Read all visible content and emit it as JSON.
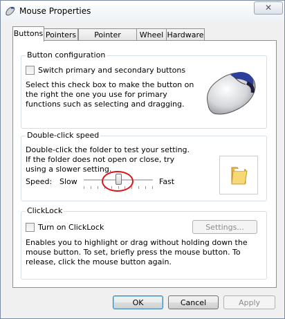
{
  "window": {
    "title": "Mouse Properties",
    "close_symbol": "✕"
  },
  "tabs": [
    {
      "label": "Buttons",
      "active": true
    },
    {
      "label": "Pointers",
      "active": false
    },
    {
      "label": "Pointer Options",
      "active": false
    },
    {
      "label": "Wheel",
      "active": false
    },
    {
      "label": "Hardware",
      "active": false
    }
  ],
  "button_config": {
    "title": "Button configuration",
    "checkbox_label": "Switch primary and secondary buttons",
    "checked": false,
    "description": "Select this check box to make the button on the right the one you use for primary functions such as selecting and dragging."
  },
  "double_click": {
    "title": "Double-click speed",
    "description": "Double-click the folder to test your setting. If the folder does not open or close, try using a slower setting.",
    "speed_label": "Speed:",
    "slow_label": "Slow",
    "fast_label": "Fast",
    "speed_level": 0.5,
    "tick_count": 11,
    "annotation_color": "#e0101a"
  },
  "clicklock": {
    "title": "ClickLock",
    "checkbox_label": "Turn on ClickLock",
    "checked": false,
    "settings_button": "Settings...",
    "description": "Enables you to highlight or drag without holding down the mouse button. To set, briefly press the mouse button. To release, click the mouse button again."
  },
  "footer": {
    "ok": "OK",
    "cancel": "Cancel",
    "apply": "Apply"
  },
  "icons": {
    "title": "mouse-icon",
    "mouse_image": "mouse-image",
    "folder": "folder-icon"
  }
}
